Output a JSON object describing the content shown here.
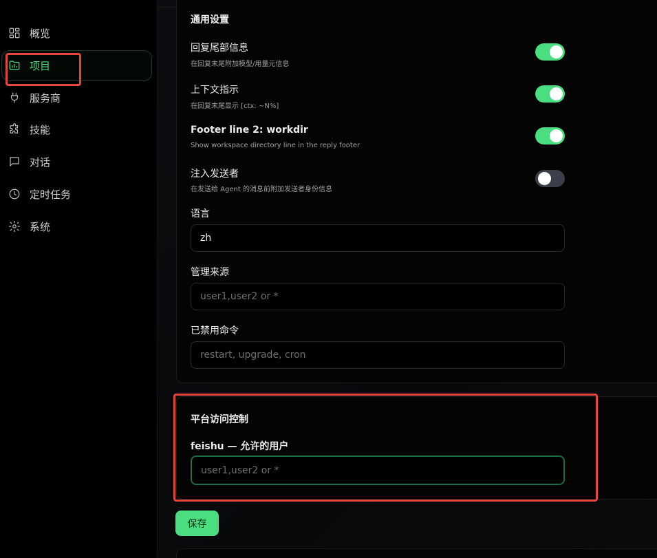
{
  "sidebar": {
    "items": [
      {
        "label": "概览",
        "icon": "dashboard-icon"
      },
      {
        "label": "项目",
        "icon": "folder-chart-icon",
        "active": true
      },
      {
        "label": "服务商",
        "icon": "plug-icon"
      },
      {
        "label": "技能",
        "icon": "puzzle-icon"
      },
      {
        "label": "对话",
        "icon": "chat-icon"
      },
      {
        "label": "定时任务",
        "icon": "clock-icon"
      },
      {
        "label": "系统",
        "icon": "gear-icon"
      }
    ]
  },
  "general": {
    "title": "通用设置",
    "toggles": [
      {
        "title": "回复尾部信息",
        "desc": "在回复末尾附加模型/用量元信息",
        "on": true
      },
      {
        "title": "上下文指示",
        "desc": "在回复末尾显示 [ctx: ~N%]",
        "on": true
      },
      {
        "title": "Footer line 2: workdir",
        "desc": "Show workspace directory line in the reply footer",
        "on": true
      },
      {
        "title": "注入发送者",
        "desc": "在发送给 Agent 的消息前附加发送者身份信息",
        "on": false
      }
    ],
    "language": {
      "label": "语言",
      "value": "zh"
    },
    "admin_from": {
      "label": "管理来源",
      "placeholder": "user1,user2 or *"
    },
    "disabled_commands": {
      "label": "已禁用命令",
      "placeholder": "restart, upgrade, cron"
    }
  },
  "platform_access": {
    "title": "平台访问控制",
    "field_label": "feishu — 允许的用户",
    "placeholder": "user1,user2 or *"
  },
  "save_label": "保存",
  "colors": {
    "accent": "#4ade80",
    "annotation": "#e4453d"
  }
}
